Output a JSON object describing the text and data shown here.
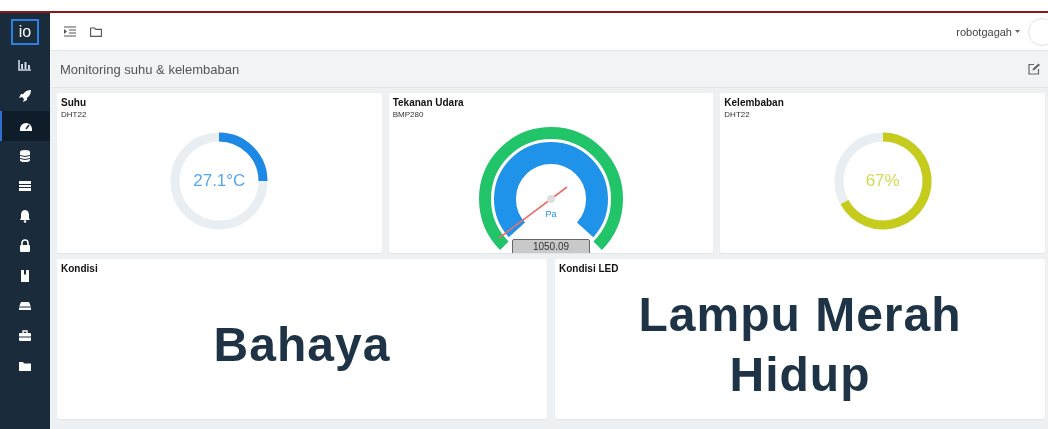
{
  "top_bar": {
    "user": "robotgagah"
  },
  "sidebar": {
    "logo": "io",
    "items": [
      {
        "kind": "chart",
        "selected": false
      },
      {
        "kind": "rocket",
        "selected": false
      },
      {
        "kind": "gauge",
        "selected": true
      },
      {
        "kind": "database",
        "selected": false
      },
      {
        "kind": "table",
        "selected": false
      },
      {
        "kind": "bell",
        "selected": false
      },
      {
        "kind": "lock",
        "selected": false
      },
      {
        "kind": "book",
        "selected": false
      },
      {
        "kind": "drive",
        "selected": false
      },
      {
        "kind": "briefcase",
        "selected": false
      },
      {
        "kind": "folder",
        "selected": false
      }
    ]
  },
  "page": {
    "title": "Monitoring suhu & kelembaban"
  },
  "widgets": [
    {
      "kind": "ring",
      "title": "Suhu",
      "subtitle": "DHT22",
      "value": "27.1°C",
      "color": "#1e88e5"
    },
    {
      "kind": "speedometer",
      "title": "Tekanan Udara",
      "subtitle": "BMP280",
      "unit": "Pa",
      "value": "1050.09"
    },
    {
      "kind": "ring",
      "title": "Kelembaban",
      "subtitle": "DHT22",
      "value": "67%",
      "color": "#c6cc1c"
    }
  ],
  "text_widgets": [
    {
      "title": "Kondisi",
      "text": "Bahaya"
    },
    {
      "title": "Kondisi LED",
      "text": "Lampu Merah Hidup"
    }
  ]
}
